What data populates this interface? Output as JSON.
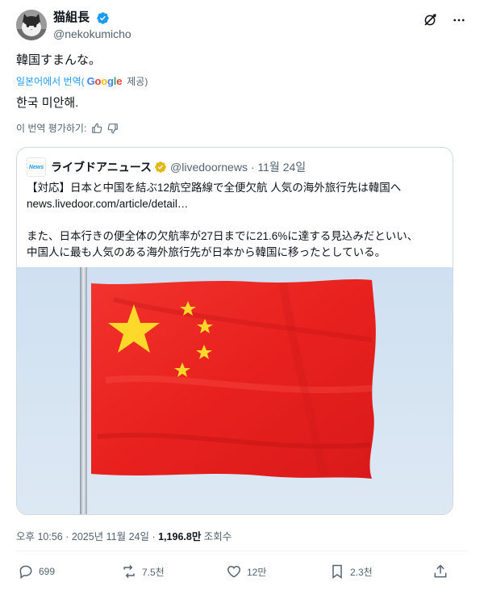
{
  "author": {
    "display_name": "猫組長",
    "handle": "@nekokumicho",
    "avatar": "cat-avatar"
  },
  "post": {
    "text": "韓国すまんな。",
    "translate_prefix": "일본어에서 번역(",
    "translate_google": "Google",
    "translate_suffix": " 제공)",
    "translated_text": "한국 미안해.",
    "rate_label": "이 번역 평가하기:"
  },
  "quote": {
    "source_logo_text": "News",
    "name": "ライブドアニュース",
    "handle_time": "@livedoornews · 11월 24일",
    "line1": "【対応】日本と中国を結ぶ12航空路線で全便欠航 人気の海外旅行先は韓国へ",
    "line2": "news.livedoor.com/article/detail…",
    "line3": "また、日本行きの便全体の欠航率が27日までに21.6%に達する見込みだといい、",
    "line4": "中国人に最も人気のある海外旅行先が日本から韓国に移ったとしている。",
    "image": "chinese-flag-photo"
  },
  "meta": {
    "time": "오후 10:56 · 2025년 11월 24일 · ",
    "views": "1,196.8만",
    "views_label": " 조회수"
  },
  "actions": {
    "replies": "699",
    "reposts": "7.5천",
    "likes": "12만",
    "bookmarks": "2.3천"
  },
  "colors": {
    "accent": "#1d9bf0",
    "text": "#0f1419",
    "muted": "#536471",
    "verified_gold": "#e2b719"
  }
}
